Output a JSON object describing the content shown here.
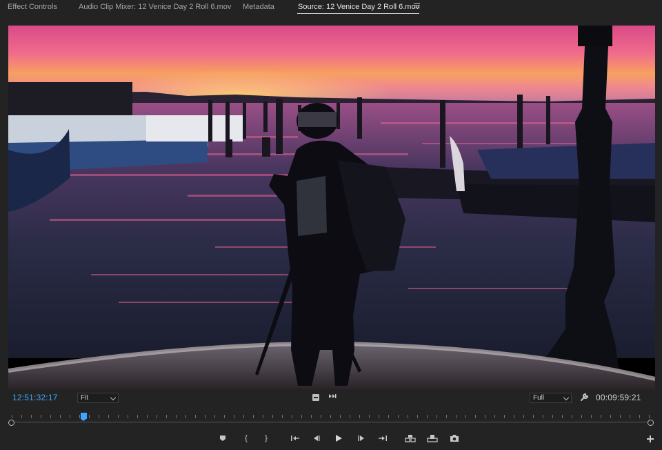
{
  "tabs": [
    {
      "label": "Effect Controls",
      "active": false
    },
    {
      "label": "Audio Clip Mixer: 12 Venice Day 2 Roll 6.mov",
      "active": false
    },
    {
      "label": "Metadata",
      "active": false
    },
    {
      "label": "Source: 12 Venice Day 2 Roll 6.mov",
      "active": true
    }
  ],
  "panel_menu_icon": "hamburger-menu-icon",
  "viewer": {
    "content": "video-frame",
    "scene": "sunset-venice-lagoon-photographer-silhouette"
  },
  "controls": {
    "current_timecode": "12:51:32:17",
    "zoom_level": "Fit",
    "resolution": "Full",
    "duration": "00:09:59:21",
    "settings_icon": "wrench-icon",
    "safe_margins_icon": "safe-margins-icon",
    "playback_rate_icon": "playback-rate-icon"
  },
  "timeline": {
    "playhead_fraction": 0.112,
    "accent_color": "#3ea6ff"
  },
  "transport": [
    {
      "name": "marker-icon",
      "glyph": ""
    },
    {
      "name": "mark-in-icon",
      "glyph": "{"
    },
    {
      "name": "mark-out-icon",
      "glyph": "}"
    },
    {
      "name": "go-to-in-icon",
      "glyph": ""
    },
    {
      "name": "step-back-icon",
      "glyph": ""
    },
    {
      "name": "play-icon",
      "glyph": ""
    },
    {
      "name": "step-forward-icon",
      "glyph": ""
    },
    {
      "name": "go-to-out-icon",
      "glyph": ""
    },
    {
      "name": "insert-icon",
      "glyph": ""
    },
    {
      "name": "overwrite-icon",
      "glyph": ""
    },
    {
      "name": "export-frame-icon",
      "glyph": ""
    }
  ],
  "button_editor_icon": "plus-icon"
}
